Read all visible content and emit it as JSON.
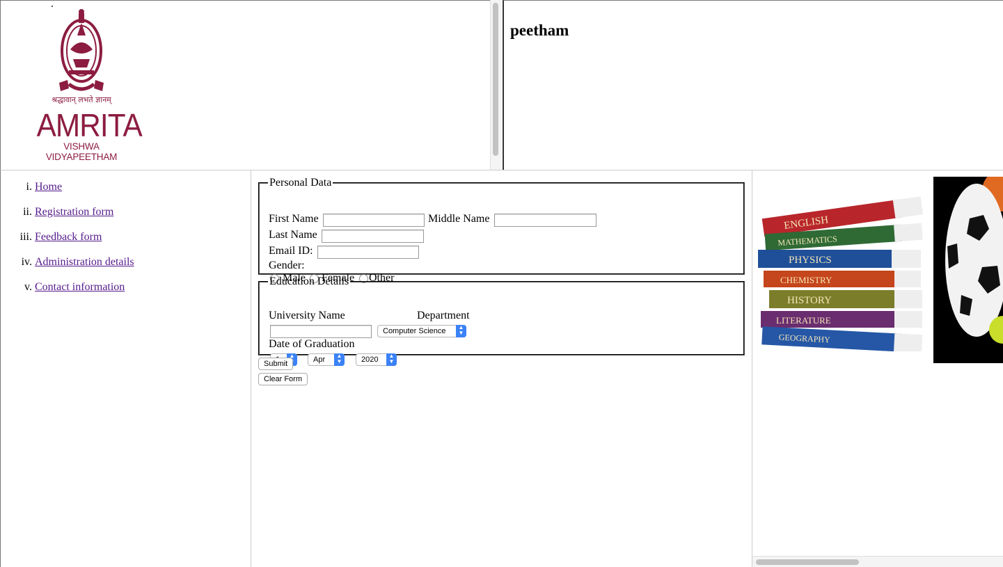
{
  "header": {
    "logo": {
      "tagline": "श्रद्धावान् लभते ज्ञानम्",
      "name": "AMRITA",
      "subtitle": "VISHWA VIDYAPEETHAM",
      "color": "#8c1d40"
    },
    "title_fragment": "peetham"
  },
  "nav": {
    "items": [
      {
        "label": "Home"
      },
      {
        "label": "Registration form"
      },
      {
        "label": "Feedback form"
      },
      {
        "label": "Administration details"
      },
      {
        "label": "Contact information"
      }
    ],
    "link_color": "#551a8b"
  },
  "form": {
    "personal": {
      "legend": "Personal Data",
      "first_name_label": "First Name",
      "middle_name_label": "Middle Name",
      "last_name_label": "Last Name",
      "email_label": "Email ID:",
      "gender_label": "Gender:",
      "gender_options": [
        "Male",
        "Female",
        "Other"
      ]
    },
    "education": {
      "legend": "Education Details",
      "university_label": "University Name",
      "department_label": "Department",
      "department_selected": "Computer Science",
      "graduation_label": "Date of Graduation",
      "day_selected": "1",
      "month_selected": "Apr",
      "year_selected": "2020"
    },
    "submit_label": "Submit",
    "clear_label": "Clear Form"
  },
  "media": {
    "books": [
      "ENGLISH",
      "MATHEMATICS",
      "PHYSICS",
      "CHEMISTRY",
      "HISTORY",
      "LITERATURE",
      "GEOGRAPHY"
    ]
  }
}
